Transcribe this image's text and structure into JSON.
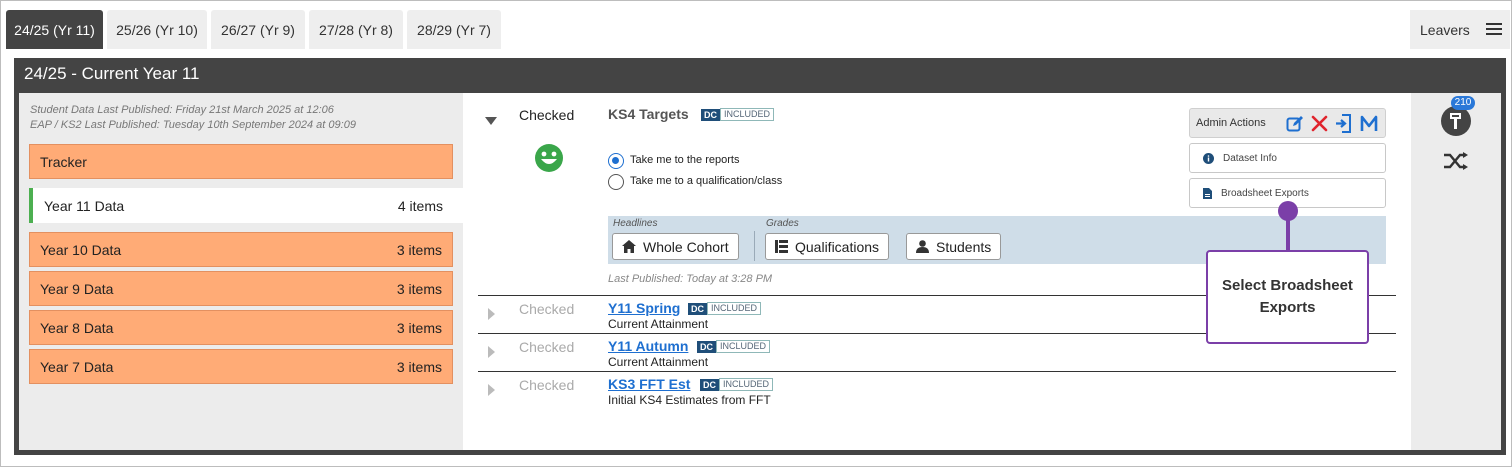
{
  "tabs": [
    {
      "label": "24/25 (Yr 11)",
      "active": true
    },
    {
      "label": "25/26 (Yr 10)",
      "active": false
    },
    {
      "label": "26/27 (Yr 9)",
      "active": false
    },
    {
      "label": "27/28 (Yr 8)",
      "active": false
    },
    {
      "label": "28/29 (Yr 7)",
      "active": false
    }
  ],
  "leavers_label": "Leavers",
  "panel_title": "24/25 - Current Year 11",
  "meta": {
    "student_published": "Student Data Last Published: Friday 21st March 2025 at 12:06",
    "eap_published": "EAP / KS2 Last Published: Tuesday 10th September 2024 at 09:09"
  },
  "sidebar": {
    "tracker": "Tracker",
    "active_item": {
      "label": "Year 11 Data",
      "count": "4 items"
    },
    "items": [
      {
        "label": "Year 10 Data",
        "count": "3 items"
      },
      {
        "label": "Year 9 Data",
        "count": "3 items"
      },
      {
        "label": "Year 8 Data",
        "count": "3 items"
      },
      {
        "label": "Year 7 Data",
        "count": "3 items"
      }
    ]
  },
  "main_dataset": {
    "status": "Checked",
    "title": "KS4 Targets",
    "dc": "DC",
    "included": "INCLUDED",
    "radio_reports": "Take me to the reports",
    "radio_qualification": "Take me to a qualification/class",
    "headlines_label": "Headlines",
    "grades_label": "Grades",
    "whole_cohort": "Whole Cohort",
    "qualifications": "Qualifications",
    "students": "Students",
    "last_published": "Last Published: Today at 3:28 PM"
  },
  "admin": {
    "label": "Admin Actions",
    "dataset_info": "Dataset Info",
    "broadsheet_exports": "Broadsheet Exports"
  },
  "rows": [
    {
      "status": "Checked",
      "title": "Y11 Spring",
      "dc": "DC",
      "included": "INCLUDED",
      "subtitle": "Current Attainment"
    },
    {
      "status": "Checked",
      "title": "Y11 Autumn",
      "dc": "DC",
      "included": "INCLUDED",
      "subtitle": "Current Attainment"
    },
    {
      "status": "Checked",
      "title": "KS3 FFT Est",
      "dc": "DC",
      "included": "INCLUDED",
      "subtitle": "Initial KS4 Estimates from FFT"
    }
  ],
  "right_badge": "210",
  "callout_text": "Select Broadsheet Exports",
  "colors": {
    "dark_panel": "#444444",
    "orange_item": "#ffab76",
    "accent_blue": "#1e6fd0",
    "callout_purple": "#7b3fa8",
    "smiley_green": "#3aa64a"
  }
}
